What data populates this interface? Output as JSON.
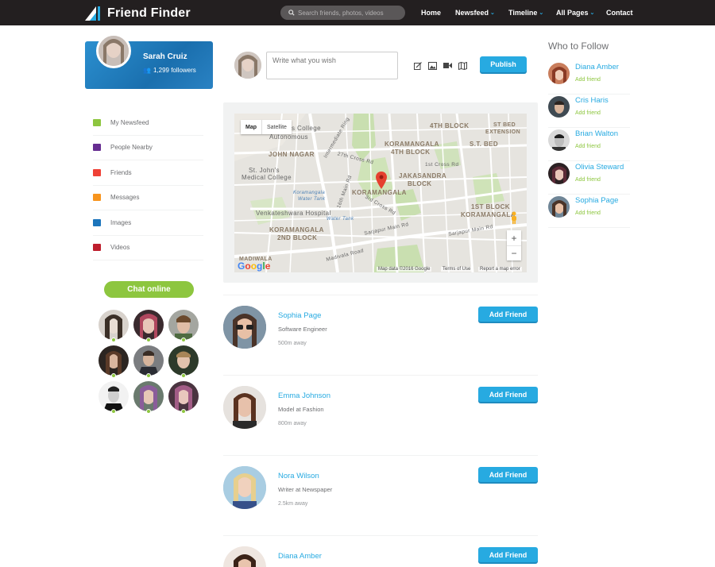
{
  "brand": {
    "name": "Friend Finder"
  },
  "search": {
    "placeholder": "Search friends, photos, videos"
  },
  "nav": [
    {
      "label": "Home",
      "has_dropdown": false
    },
    {
      "label": "Newsfeed",
      "has_dropdown": true
    },
    {
      "label": "Timeline",
      "has_dropdown": true
    },
    {
      "label": "All Pages",
      "has_dropdown": true
    },
    {
      "label": "Contact",
      "has_dropdown": false
    }
  ],
  "profile": {
    "name": "Sarah Cruiz",
    "followers": "1,299 followers"
  },
  "menu": [
    {
      "label": "My Newsfeed",
      "icon": "newsfeed-icon",
      "color": "#8dc63f"
    },
    {
      "label": "People Nearby",
      "icon": "people-icon",
      "color": "#662d91"
    },
    {
      "label": "Friends",
      "icon": "friends-icon",
      "color": "#ef4136"
    },
    {
      "label": "Messages",
      "icon": "messages-icon",
      "color": "#f7941d"
    },
    {
      "label": "Images",
      "icon": "images-icon",
      "color": "#1c75bc"
    },
    {
      "label": "Videos",
      "icon": "videos-icon",
      "color": "#be1e2d"
    }
  ],
  "chat": {
    "label": "Chat online"
  },
  "post": {
    "placeholder": "Write what you wish",
    "publish_label": "Publish"
  },
  "map": {
    "tab_map": "Map",
    "tab_satellite": "Satellite",
    "google": "Google",
    "footer_data": "Map data ©2016 Google",
    "footer_terms": "Terms of Use",
    "footer_report": "Report a map error",
    "zoom_in": "+",
    "zoom_out": "−",
    "labels": {
      "l1": "4TH BLOCK",
      "l2": "ST BED",
      "l3": "EXTENSION",
      "l4": "KORAMANGALA",
      "l5": "4TH BLOCK",
      "l6": "S.T. BED",
      "l7": "JOHN NAGAR",
      "l8": "JAKASANDRA",
      "l9": "BLOCK",
      "l10": "KORAMANGALA",
      "l11": "1ST BLOCK",
      "l12": "KORAMANGALA",
      "l13": "KORAMANGALA",
      "l14": "2ND BLOCK",
      "l15": "MADIWALA",
      "s1": "s College",
      "s2": "Autonomous",
      "s3": "St. John's",
      "s4": "Medical College",
      "s5": "Venkateshwara Hospital",
      "s6": "Sarjapur Main Rd",
      "s7": "Madivala Road",
      "s8": "Sarjapur Main Rd",
      "s9": "3rd Cross Rd",
      "s10": "1st Cross Rd",
      "s11": "27th Cross Rd",
      "s12": "16th Main Rd",
      "s13": "Intermediate Ring",
      "b1": "Koramangala",
      "b2": "Water Tank",
      "b3": "Water Tank"
    }
  },
  "people": [
    {
      "name": "Sophia Page",
      "job": "Software Engineer",
      "distance": "500m away",
      "button": "Add Friend"
    },
    {
      "name": "Emma Johnson",
      "job": "Model at Fashion",
      "distance": "800m away",
      "button": "Add Friend"
    },
    {
      "name": "Nora Wilson",
      "job": "Writer at Newspaper",
      "distance": "2.5km away",
      "button": "Add Friend"
    },
    {
      "name": "Diana Amber",
      "job": "",
      "distance": "",
      "button": "Add Friend"
    }
  ],
  "who_to_follow": {
    "title": "Who to Follow",
    "users": [
      {
        "name": "Diana Amber",
        "action": "Add friend"
      },
      {
        "name": "Cris Haris",
        "action": "Add friend"
      },
      {
        "name": "Brian Walton",
        "action": "Add friend"
      },
      {
        "name": "Olivia Steward",
        "action": "Add friend"
      },
      {
        "name": "Sophia Page",
        "action": "Add friend"
      }
    ]
  },
  "colors": {
    "accent": "#27aae1",
    "green": "#8dc63f",
    "topbar": "#231f20"
  }
}
